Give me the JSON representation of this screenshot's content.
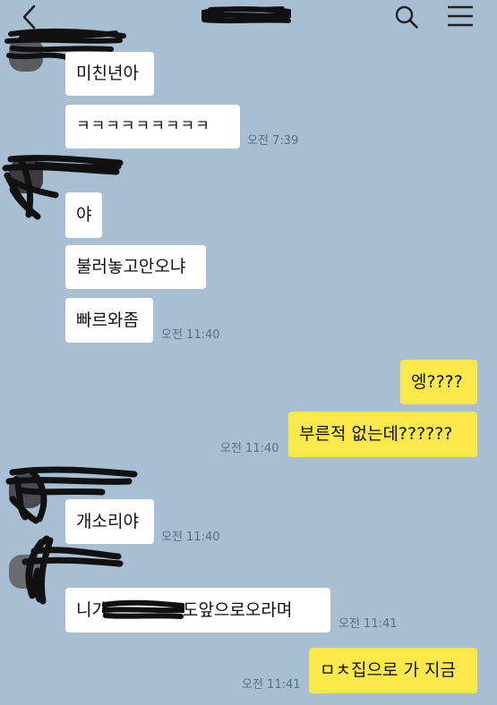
{
  "header": {
    "back_icon": "chevron-left-icon",
    "search_icon": "search-icon",
    "menu_icon": "hamburger-menu-icon"
  },
  "messages": [
    {
      "side": "in",
      "text": "미친년아",
      "time": ""
    },
    {
      "side": "in",
      "text": "ㅋㅋㅋㅋㅋㅋㅋㅋㅋ",
      "time": "오전 7:39"
    },
    {
      "side": "in",
      "text": "야",
      "time": ""
    },
    {
      "side": "in",
      "text": "불러놓고안오냐",
      "time": ""
    },
    {
      "side": "in",
      "text": "빠르와좀",
      "time": "오전 11:40"
    },
    {
      "side": "out",
      "text": "엥????",
      "time": ""
    },
    {
      "side": "out",
      "text": "부른적 없는데??????",
      "time": "오전 11:40"
    },
    {
      "side": "in",
      "text": "개소리야",
      "time": "오전 11:40"
    },
    {
      "side": "in",
      "text_before": "니가",
      "text_after": "도앞으로오라며",
      "time": "오전 11:41"
    },
    {
      "side": "out",
      "text": "ㅁㅊ집으로 가 지금",
      "time": "오전 11:41"
    }
  ],
  "colors": {
    "background": "#a7bed3",
    "incoming_bubble": "#ffffff",
    "outgoing_bubble": "#fbe84a",
    "timestamp": "#5c6f80"
  }
}
